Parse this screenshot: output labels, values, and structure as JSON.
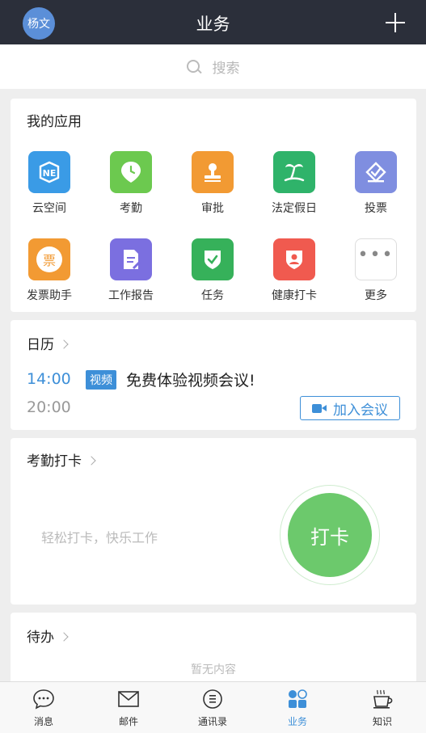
{
  "header": {
    "avatar_text": "杨文",
    "title": "业务"
  },
  "search": {
    "placeholder": "搜索"
  },
  "my_apps": {
    "title": "我的应用",
    "items": [
      {
        "label": "云空间",
        "icon": "cloud-space-icon",
        "color": "#3a9be6"
      },
      {
        "label": "考勤",
        "icon": "attendance-pin-icon",
        "color": "#6cc94f"
      },
      {
        "label": "审批",
        "icon": "stamp-icon",
        "color": "#f29a33"
      },
      {
        "label": "法定假日",
        "icon": "palm-tree-icon",
        "color": "#2fb36a"
      },
      {
        "label": "投票",
        "icon": "vote-icon",
        "color": "#7f8ee0"
      },
      {
        "label": "发票助手",
        "icon": "invoice-icon",
        "color": "#f29a33"
      },
      {
        "label": "工作报告",
        "icon": "report-icon",
        "color": "#7b6fe0"
      },
      {
        "label": "任务",
        "icon": "task-shield-icon",
        "color": "#36b15a"
      },
      {
        "label": "健康打卡",
        "icon": "health-shield-icon",
        "color": "#f05a4f"
      },
      {
        "label": "更多",
        "icon": "more-icon",
        "color": "#ffffff"
      }
    ]
  },
  "calendar": {
    "title": "日历",
    "start_time": "14:00",
    "end_time": "20:00",
    "badge": "视频",
    "event_title": "免费体验视频会议!",
    "join_label": "加入会议"
  },
  "attendance": {
    "title": "考勤打卡",
    "slogan": "轻松打卡，快乐工作",
    "clock_label": "打卡"
  },
  "todo": {
    "title": "待办",
    "empty_text": "暂无内容"
  },
  "tabs": [
    {
      "label": "消息",
      "icon": "message-icon",
      "active": false
    },
    {
      "label": "邮件",
      "icon": "mail-icon",
      "active": false
    },
    {
      "label": "通讯录",
      "icon": "contacts-icon",
      "active": false
    },
    {
      "label": "业务",
      "icon": "business-grid-icon",
      "active": true
    },
    {
      "label": "知识",
      "icon": "coffee-cup-icon",
      "active": false
    }
  ]
}
